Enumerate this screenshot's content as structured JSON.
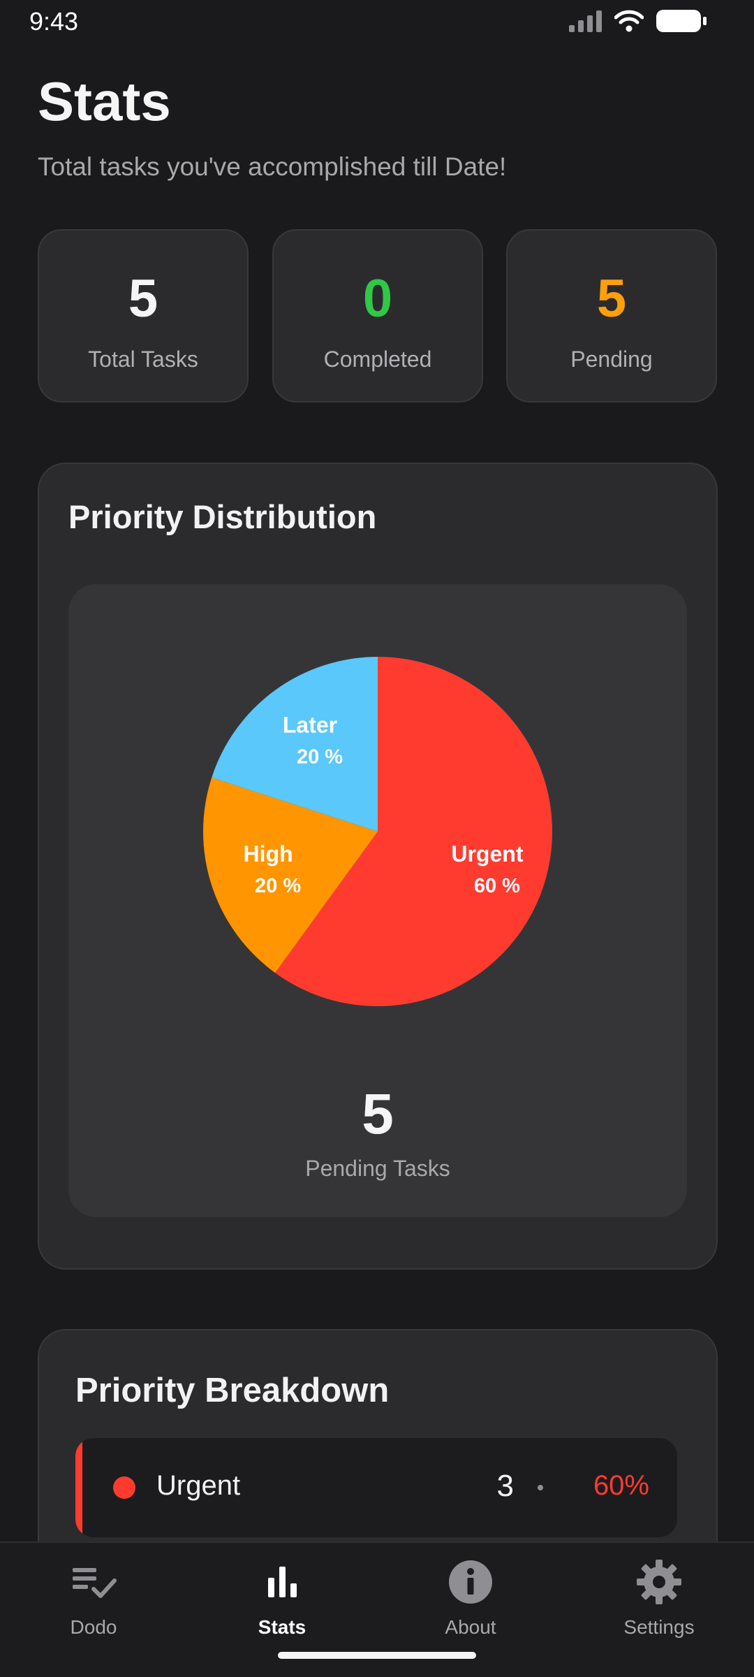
{
  "status_bar": {
    "time": "9:43"
  },
  "header": {
    "title": "Stats",
    "subtitle": "Total tasks you've accomplished till Date!"
  },
  "stats": [
    {
      "value": "5",
      "label": "Total Tasks",
      "color": "#f5f5f5"
    },
    {
      "value": "0",
      "label": "Completed",
      "color": "#30c846"
    },
    {
      "value": "5",
      "label": "Pending",
      "color": "#ff9f0a"
    }
  ],
  "distribution": {
    "title": "Priority Distribution",
    "pending_value": "5",
    "pending_label": "Pending Tasks"
  },
  "chart_data": {
    "type": "pie",
    "categories": [
      "Urgent",
      "High",
      "Later"
    ],
    "values": [
      60,
      20,
      20
    ],
    "value_labels": [
      "60 %",
      "20 %",
      "20 %"
    ],
    "colors": [
      "#ff3b30",
      "#ff9500",
      "#5ac8fa"
    ]
  },
  "breakdown": {
    "title": "Priority Breakdown",
    "rows": [
      {
        "label": "Urgent",
        "count": "3",
        "percent": "60%",
        "color": "#ff3b30"
      }
    ]
  },
  "nav": {
    "items": [
      {
        "label": "Dodo",
        "icon": "checklist-icon",
        "active": false
      },
      {
        "label": "Stats",
        "icon": "bar-chart-icon",
        "active": true
      },
      {
        "label": "About",
        "icon": "info-icon",
        "active": false
      },
      {
        "label": "Settings",
        "icon": "gear-icon",
        "active": false
      }
    ]
  }
}
